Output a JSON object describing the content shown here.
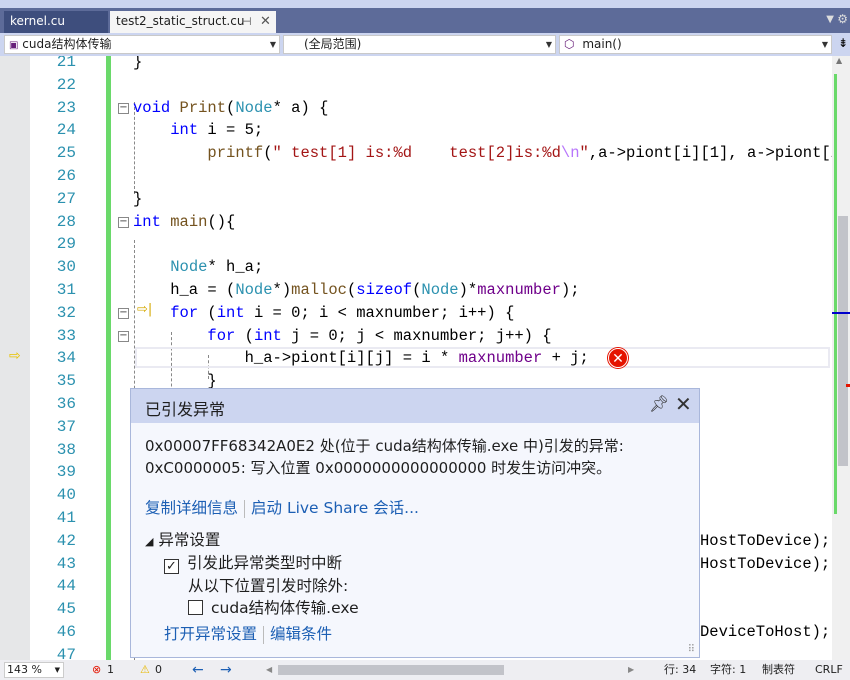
{
  "tabs": [
    {
      "label": "kernel.cu",
      "active": false
    },
    {
      "label": "test2_static_struct.cu",
      "active": true
    }
  ],
  "tab_icons": {
    "pin": "pin-icon",
    "close": "close-icon"
  },
  "navbar": {
    "project": "cuda结构体传输",
    "scope": "(全局范围)",
    "member": "main()"
  },
  "code_lines": [
    {
      "n": "21",
      "html": "}"
    },
    {
      "n": "22",
      "html": ""
    },
    {
      "n": "23",
      "html": "<span class='kw'>void</span> <span class='fn'>Print</span>(<span class='ty'>Node</span>* a) {"
    },
    {
      "n": "24",
      "html": "    <span class='kw'>int</span> i = 5;"
    },
    {
      "n": "25",
      "html": "        <span class='fn'>printf</span>(<span class='str'>\" test[1] is:%d    test[2]is:%d</span><span class='esc'>\\n</span><span class='str'>\"</span>,a->piont[i][1], a->piont[i"
    },
    {
      "n": "26",
      "html": ""
    },
    {
      "n": "27",
      "html": "}"
    },
    {
      "n": "28",
      "html": "<span class='kw'>int</span> <span class='fn'>main</span>(){"
    },
    {
      "n": "29",
      "html": ""
    },
    {
      "n": "30",
      "html": "    <span class='ty'>Node</span>* h_a;"
    },
    {
      "n": "31",
      "html": "    h_a = (<span class='ty'>Node</span>*)<span class='fn'>malloc</span>(<span class='kw'>sizeof</span>(<span class='ty'>Node</span>)*<span class='mac'>maxnumber</span>);"
    },
    {
      "n": "32",
      "html": "    <span class='kw'>for</span> (<span class='kw'>int</span> i = 0; i &lt; maxnumber; i++) {"
    },
    {
      "n": "33",
      "html": "        <span class='kw'>for</span> (<span class='kw'>int</span> j = 0; j &lt; maxnumber; j++) {"
    },
    {
      "n": "34",
      "html": "            h_a->piont[i][j] = i * <span class='mac'>maxnumber</span> + j;"
    },
    {
      "n": "35",
      "html": "        }"
    },
    {
      "n": "36",
      "html": ""
    },
    {
      "n": "37",
      "html": ""
    },
    {
      "n": "38",
      "html": ""
    },
    {
      "n": "39",
      "html": ""
    },
    {
      "n": "40",
      "html": ""
    },
    {
      "n": "41",
      "html": ""
    },
    {
      "n": "42",
      "html": ""
    },
    {
      "n": "43",
      "html": ""
    },
    {
      "n": "44",
      "html": ""
    },
    {
      "n": "45",
      "html": ""
    },
    {
      "n": "46",
      "html": ""
    },
    {
      "n": "47",
      "html": ""
    }
  ],
  "code_fragments": {
    "42": "HostToDevice);",
    "43": "HostToDevice);",
    "46": "DeviceToHost);"
  },
  "exception": {
    "title": "已引发异常",
    "message_line1": "0x00007FF68342A0E2 处(位于 cuda结构体传输.exe 中)引发的异常:",
    "message_line2": "0xC0000005: 写入位置 0x0000000000000000 时发生访问冲突。",
    "link_copy": "复制详细信息",
    "link_liveshare": "启动 Live Share 会话...",
    "settings_header": "异常设置",
    "break_label": "引发此异常类型时中断",
    "break_checked": true,
    "except_label": "从以下位置引发时除外:",
    "module_label": "cuda结构体传输.exe",
    "module_checked": false,
    "link_open_settings": "打开异常设置",
    "link_edit_conditions": "编辑条件"
  },
  "status": {
    "zoom": "143 %",
    "errors": "1",
    "warnings": "0",
    "line": "行: 34",
    "char": "字符: 1",
    "tabs": "制表符",
    "eol": "CRLF"
  },
  "colors": {
    "keyword": "#0000ff",
    "type": "#2b91af",
    "macro": "#6f008a",
    "string": "#a31515",
    "error": "#e51400",
    "link": "#1c5fb4",
    "tabbar": "#5d6b99"
  }
}
